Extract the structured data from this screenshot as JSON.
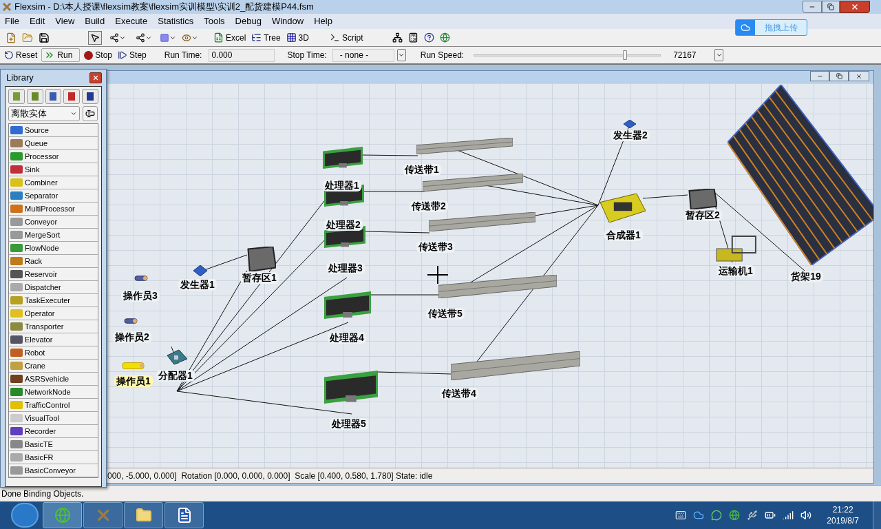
{
  "window": {
    "title": "Flexsim - D:\\本人授课\\flexsim教案\\flexsim实训模型\\实训2_配货建模P44.fsm"
  },
  "menu": [
    "File",
    "Edit",
    "View",
    "Build",
    "Execute",
    "Statistics",
    "Tools",
    "Debug",
    "Window",
    "Help"
  ],
  "mode_tools": [
    {
      "selected": true
    },
    {
      "selected": false
    },
    {
      "selected": false
    }
  ],
  "toolbar_buttons": [
    "Excel",
    "Tree",
    "3D",
    "Script"
  ],
  "run_bar": {
    "reset": "Reset",
    "run": "Run",
    "stop": "Stop",
    "step": "Step",
    "run_time": {
      "label": "Run Time:",
      "value": "0.000"
    },
    "stop_time": {
      "label": "Stop Time:",
      "value": "- none -"
    },
    "run_speed": {
      "label": "Run Speed:",
      "level": 0.81,
      "reading": "72167"
    }
  },
  "upload_button": "拖拽上传",
  "library": {
    "title": "Library",
    "category": "离散实体",
    "items": [
      "Source",
      "Queue",
      "Processor",
      "Sink",
      "Combiner",
      "Separator",
      "MultiProcessor",
      "Conveyor",
      "MergeSort",
      "FlowNode",
      "Rack",
      "Reservoir",
      "Dispatcher",
      "TaskExecuter",
      "Operator",
      "Transporter",
      "Elevator",
      "Robot",
      "Crane",
      "ASRSvehicle",
      "NetworkNode",
      "TrafficControl",
      "VisualTool",
      "Recorder",
      "BasicTE",
      "BasicFR",
      "BasicConveyor"
    ]
  },
  "model_view": {
    "objects": [
      {
        "label": "发生器2",
        "kind": "source",
        "selected": false
      },
      {
        "label": "传送带1",
        "kind": "conveyor",
        "selected": false
      },
      {
        "label": "处理器1",
        "kind": "processor",
        "selected": false
      },
      {
        "label": "传送带2",
        "kind": "conveyor",
        "selected": false
      },
      {
        "label": "暂存区2",
        "kind": "queue",
        "selected": false
      },
      {
        "label": "处理器2",
        "kind": "processor",
        "selected": false
      },
      {
        "label": "合成器1",
        "kind": "combiner",
        "selected": false
      },
      {
        "label": "传送带3",
        "kind": "conveyor",
        "selected": false
      },
      {
        "label": "处理器3",
        "kind": "processor",
        "selected": false
      },
      {
        "label": "运输机1",
        "kind": "transporter",
        "selected": false
      },
      {
        "label": "暂存区1",
        "kind": "queue",
        "selected": false
      },
      {
        "label": "货架19",
        "kind": "rack",
        "selected": false
      },
      {
        "label": "发生器1",
        "kind": "source",
        "selected": false
      },
      {
        "label": "操作员3",
        "kind": "operator",
        "selected": false
      },
      {
        "label": "传送带5",
        "kind": "conveyor",
        "selected": false
      },
      {
        "label": "操作员2",
        "kind": "operator",
        "selected": false
      },
      {
        "label": "处理器4",
        "kind": "processor",
        "selected": false
      },
      {
        "label": "分配器1",
        "kind": "dispatcher",
        "selected": false
      },
      {
        "label": "操作员1",
        "kind": "operator",
        "selected": true
      },
      {
        "label": "传送带4",
        "kind": "conveyor",
        "selected": false
      },
      {
        "label": "处理器5",
        "kind": "processor",
        "selected": false
      }
    ],
    "status": "000, -5.000, 0.000]  Rotation [0.000, 0.000, 0.000]  Scale [0.400, 0.580, 1.780] State: idle"
  },
  "status_bar": "Done Binding Objects.",
  "taskbar": {
    "time": "21:22",
    "date": "2019/8/7"
  }
}
